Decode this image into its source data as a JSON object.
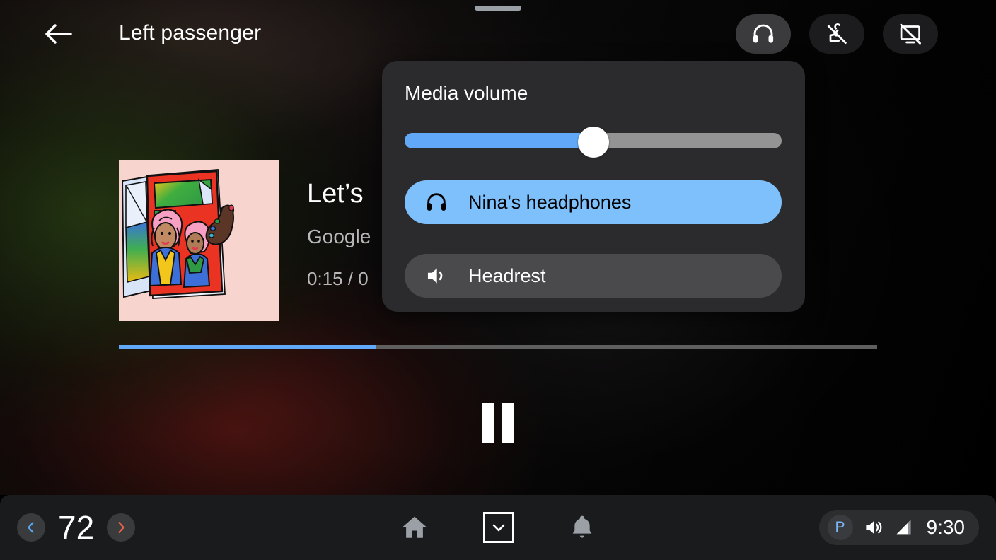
{
  "topbar": {
    "back_icon": "arrow-left-icon",
    "title": "Left passenger",
    "buttons": [
      {
        "name": "headphones",
        "icon": "headphones-icon",
        "active": true
      },
      {
        "name": "mic-off",
        "icon": "mic-off-icon",
        "active": false
      },
      {
        "name": "screen-off",
        "icon": "screen-off-icon",
        "active": false
      }
    ]
  },
  "now_playing": {
    "title": "Let’s",
    "artist": "Google",
    "time": "0:15 / 0",
    "progress_percent": 34,
    "transport": {
      "pause_icon": "pause-icon"
    },
    "album_art_alt": "illustration of two women with pink hair holding a magazine"
  },
  "volume_popup": {
    "title": "Media volume",
    "slider": {
      "value_percent": 50,
      "fill_color": "#61a9f8",
      "track_color": "#949494",
      "thumb_color": "#ffffff"
    },
    "devices": [
      {
        "label": "Nina's headphones",
        "icon": "headphones-icon",
        "selected": true,
        "color": "#7ec0fb"
      },
      {
        "label": "Headrest",
        "icon": "speaker-icon",
        "selected": false,
        "color": "#4a4a4d"
      }
    ]
  },
  "navbar": {
    "temperature": {
      "value": "72",
      "decrease_icon": "chevron-left-icon",
      "increase_icon": "chevron-right-icon",
      "decrease_color": "#5aa7f0",
      "increase_color": "#e8654a"
    },
    "center_icons": [
      {
        "name": "home-icon"
      },
      {
        "name": "chevron-down-icon"
      },
      {
        "name": "bell-icon"
      }
    ],
    "status": {
      "park_label": "P",
      "volume_icon": "volume-icon",
      "signal_icon": "signal-icon",
      "clock": "9:30"
    }
  }
}
